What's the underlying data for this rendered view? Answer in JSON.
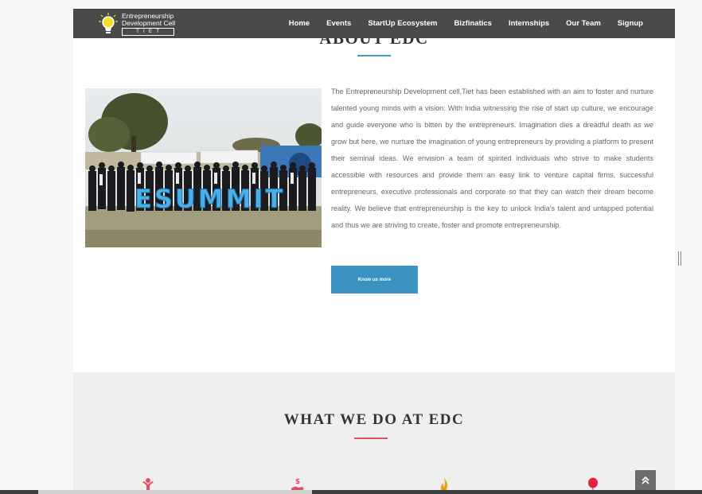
{
  "brand": {
    "line1": "Entrepreneurship",
    "line2": "Development Cell",
    "line3": "TIET",
    "colors": {
      "navbar": "#4a4a4a",
      "accent_blue": "#3a93c2",
      "accent_red": "#e04e63",
      "bulb_yellow": "#f7e02a"
    }
  },
  "nav": {
    "items": [
      {
        "label": "Home"
      },
      {
        "label": "Events"
      },
      {
        "label": "StartUp Ecosystem"
      },
      {
        "label": "Bizfinatics"
      },
      {
        "label": "Internships"
      },
      {
        "label": "Our Team"
      },
      {
        "label": "Signup"
      }
    ]
  },
  "about": {
    "title": "ABOUT EDC",
    "photo_banner_text": "ESUMMIT",
    "description": "The Entrepreneurship Development cell,Tiet has been established with an aim to foster and nurture talented young minds with a vision. With India witnessing the rise of start up culture, we encourage and guide everyone who is bitten by the entrepreneurs. Imagination dies a dreadful death as we grow but here, we nurture the imagination of young entrepreneurs by providing a platform to present their seminal ideas. We envision a team of spirited individuals who strive to make students accessible with resources and provide them an easy link to venture capital firms, successful entrepreneurs, executive professionals and corporate so that they can watch their dream become reality. We believe that entrepreneurship is the key to unlock India's talent and untapped potential and thus we are striving to create, foster and promote entrepreneurship.",
    "button_label": "Know us more"
  },
  "what_we_do": {
    "title": "WHAT WE DO AT EDC",
    "icons": [
      "person-raise-icon",
      "money-hand-icon",
      "flame-icon",
      "balloon-icon"
    ]
  },
  "controls": {
    "back_to_top_icon": "double-chevron-up-icon"
  }
}
